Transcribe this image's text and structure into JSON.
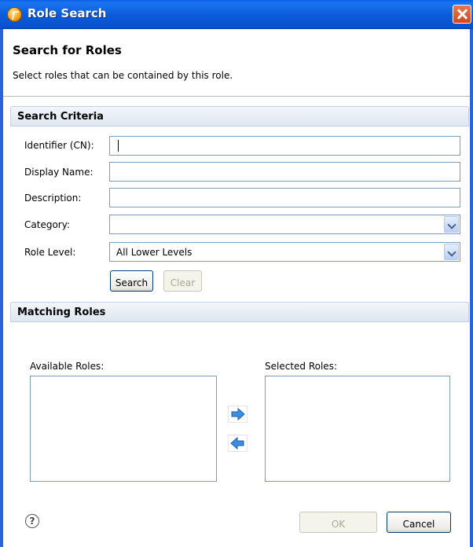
{
  "window": {
    "title": "Role Search"
  },
  "header": {
    "title": "Search for Roles",
    "description": "Select roles that can be contained by this role."
  },
  "search_criteria": {
    "section_title": "Search Criteria",
    "identifier_label": "Identifier (CN):",
    "identifier_value": "",
    "display_name_label": "Display Name:",
    "display_name_value": "",
    "description_label": "Description:",
    "description_value": "",
    "category_label": "Category:",
    "category_value": "",
    "role_level_label": "Role Level:",
    "role_level_value": "All Lower Levels",
    "search_button": "Search",
    "clear_button": "Clear"
  },
  "matching_roles": {
    "section_title": "Matching Roles",
    "available_label": "Available Roles:",
    "selected_label": "Selected Roles:",
    "available_items": [],
    "selected_items": []
  },
  "footer": {
    "help_icon": "question-mark-icon",
    "ok_button": "OK",
    "cancel_button": "Cancel"
  },
  "icons": {
    "add": "arrow-right-icon",
    "remove": "arrow-left-icon",
    "close": "close-x-icon",
    "app": "role-app-icon"
  },
  "colors": {
    "titlebar": "#0b5bd9",
    "close_button": "#d6451a",
    "arrow": "#3a8ee6",
    "section_header": "#dde6f1"
  }
}
